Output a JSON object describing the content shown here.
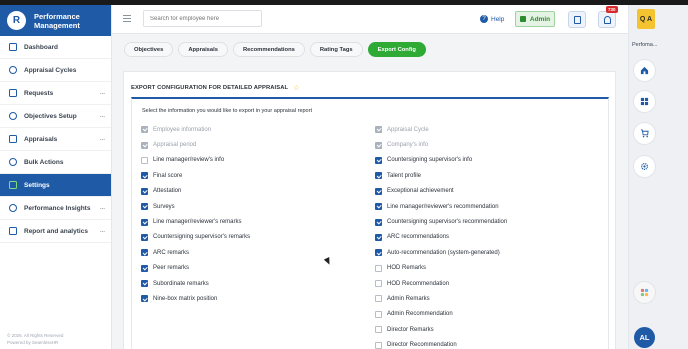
{
  "brand": {
    "logo_letter": "R",
    "name": "Performance Management"
  },
  "sidebar": {
    "items": [
      {
        "label": "Dashboard",
        "icon": "dashboard-icon"
      },
      {
        "label": "Appraisal Cycles",
        "icon": "cycle-icon"
      },
      {
        "label": "Requests",
        "icon": "requests-icon",
        "has_arrow": true
      },
      {
        "label": "Objectives Setup",
        "icon": "objectives-icon",
        "has_arrow": true
      },
      {
        "label": "Appraisals",
        "icon": "appraisals-icon",
        "has_arrow": true
      },
      {
        "label": "Bulk Actions",
        "icon": "bulk-icon"
      },
      {
        "label": "Settings",
        "icon": "gear-icon",
        "active": true
      },
      {
        "label": "Performance Insights",
        "icon": "insights-icon",
        "has_arrow": true
      },
      {
        "label": "Report and analytics",
        "icon": "report-icon",
        "has_arrow": true
      }
    ],
    "arrow_glyph": "...",
    "footer_line1": "© 2025. All Rights Reserved",
    "footer_line2": "Powered by SeamlessHR"
  },
  "topbar": {
    "search_placeholder": "Search for employee here",
    "help_label": "Help",
    "help_glyph": "?",
    "admin_label": "Admin",
    "notification_count": "730"
  },
  "rail": {
    "qa_label": "Q A",
    "label": "Perfoma...",
    "avatar_initials": "AL"
  },
  "tabs": [
    {
      "label": "Objectives"
    },
    {
      "label": "Appraisals"
    },
    {
      "label": "Recommendations"
    },
    {
      "label": "Rating Tags"
    },
    {
      "label": "Export Config",
      "active": true
    }
  ],
  "card": {
    "title": "EXPORT CONFIGURATION FOR DETAILED APPRAISAL",
    "star_glyph": "☆",
    "instruction": "Select the information you would like to export in your appraisal report"
  },
  "options_left": [
    {
      "label": "Employee information",
      "state": "disabled"
    },
    {
      "label": "Appraisal period",
      "state": "disabled"
    },
    {
      "label": "Line manager/review's info",
      "state": "off"
    },
    {
      "label": "Final score",
      "state": "on"
    },
    {
      "label": "Attestation",
      "state": "on"
    },
    {
      "label": "Surveys",
      "state": "on"
    },
    {
      "label": "Line manager/reviewer's remarks",
      "state": "on"
    },
    {
      "label": "Countersigning supervisor's remarks",
      "state": "on"
    },
    {
      "label": "ARC remarks",
      "state": "on"
    },
    {
      "label": "Peer remarks",
      "state": "on"
    },
    {
      "label": "Subordinate remarks",
      "state": "on"
    },
    {
      "label": "Nine-box matrix position",
      "state": "on"
    }
  ],
  "options_right": [
    {
      "label": "Appraisal Cycle",
      "state": "disabled"
    },
    {
      "label": "Company's info",
      "state": "disabled"
    },
    {
      "label": "Countersigning supervisor's info",
      "state": "on"
    },
    {
      "label": "Talent profile",
      "state": "on"
    },
    {
      "label": "Exceptional achievement",
      "state": "on"
    },
    {
      "label": "Line manager/reviewer's recommendation",
      "state": "on"
    },
    {
      "label": "Countersigning supervisor's recommendation",
      "state": "on"
    },
    {
      "label": "ARC recommendations",
      "state": "on"
    },
    {
      "label": "Auto-recommendation (system-generated)",
      "state": "on"
    },
    {
      "label": "HOD Remarks",
      "state": "off"
    },
    {
      "label": "HOD Recommendation",
      "state": "off"
    },
    {
      "label": "Admin Remarks",
      "state": "off"
    },
    {
      "label": "Admin Recommendation",
      "state": "off"
    },
    {
      "label": "Director Remarks",
      "state": "off"
    },
    {
      "label": "Director Recommendation",
      "state": "off"
    }
  ],
  "colors": {
    "primary": "#1f5aa6",
    "active_tab": "#2eaa35",
    "badge": "#d82a2a",
    "star": "#f2c200"
  }
}
